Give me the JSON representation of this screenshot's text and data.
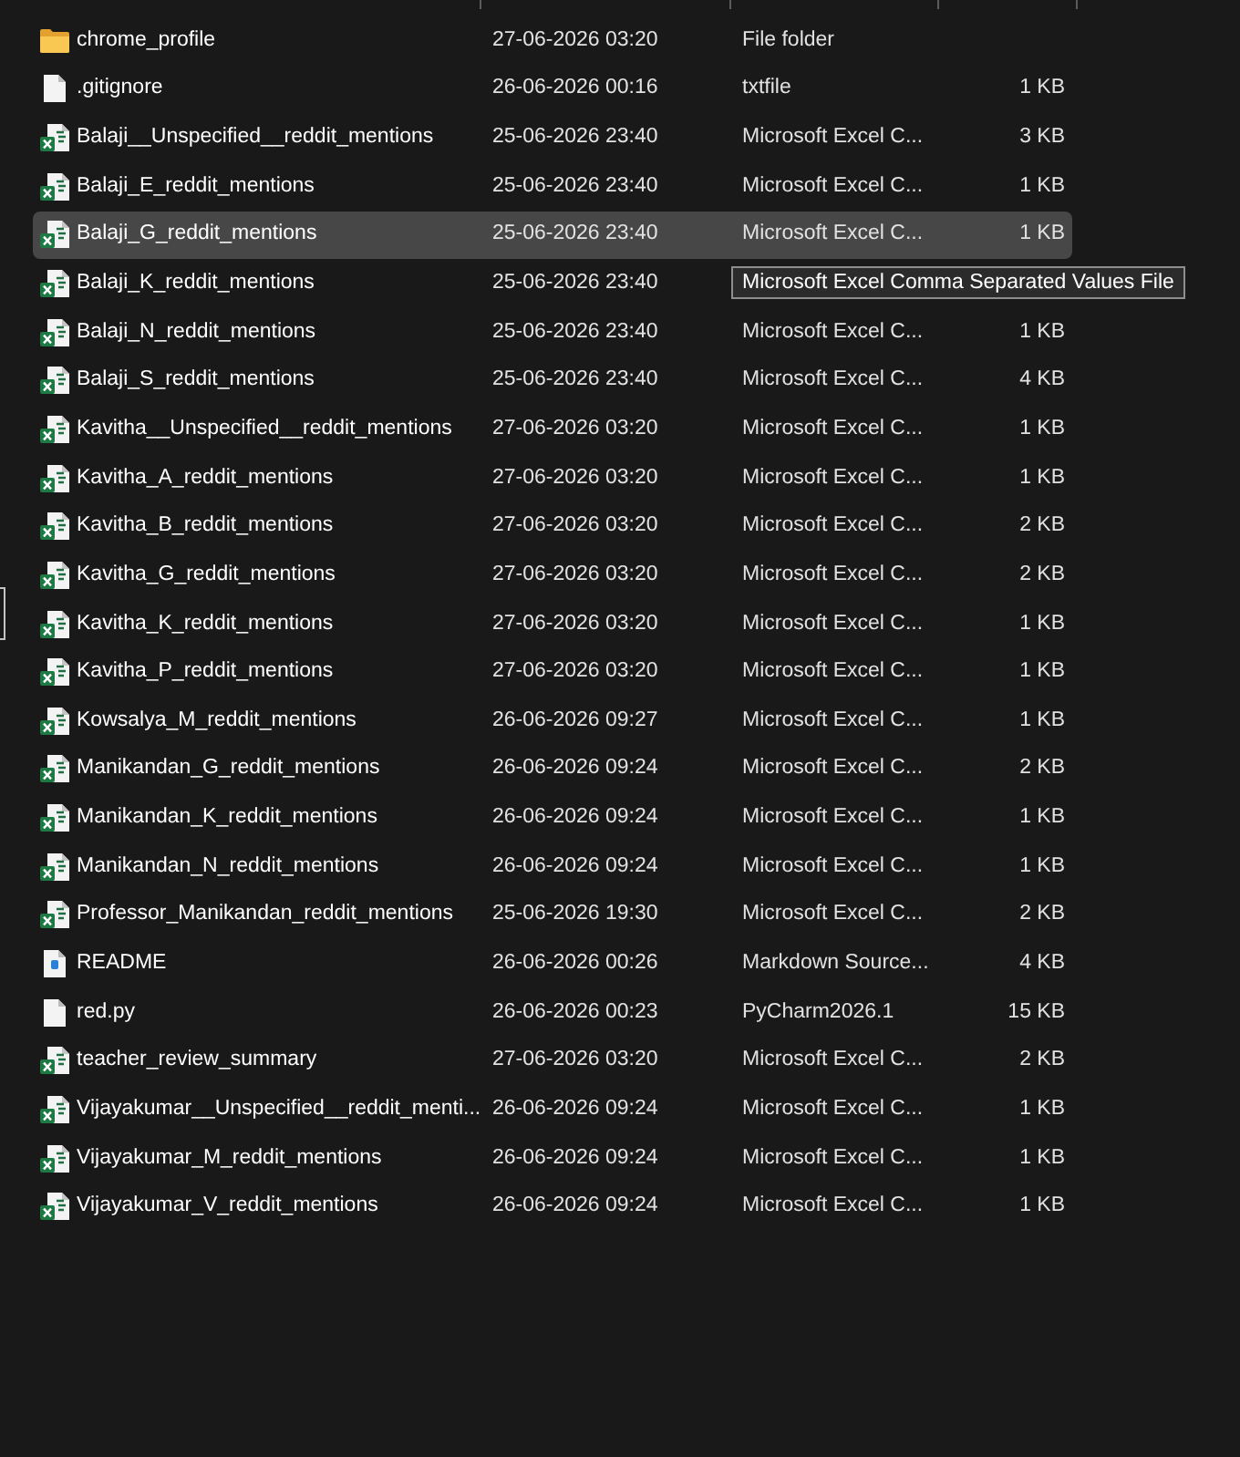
{
  "files": [
    {
      "kind": "folder",
      "name": "chrome_profile",
      "modified": "27-06-2026 03:20",
      "type": "File folder",
      "selected": false
    },
    {
      "kind": "file",
      "name": ".gitignore",
      "modified": "26-06-2026 00:16",
      "type": "txtfile",
      "size": "1 KB",
      "selected": false
    },
    {
      "kind": "csv",
      "name": "Balaji__Unspecified__reddit_mentions",
      "modified": "25-06-2026 23:40",
      "type": "Microsoft Excel C...",
      "size": "3 KB",
      "selected": false
    },
    {
      "kind": "csv",
      "name": "Balaji_E_reddit_mentions",
      "modified": "25-06-2026 23:40",
      "type": "Microsoft Excel C...",
      "size": "1 KB",
      "selected": false
    },
    {
      "kind": "csv",
      "name": "Balaji_G_reddit_mentions",
      "modified": "25-06-2026 23:40",
      "type": "Microsoft Excel C...",
      "size": "1 KB",
      "selected": true
    },
    {
      "kind": "csv",
      "name": "Balaji_K_reddit_mentions",
      "modified": "25-06-2026 23:40",
      "tooltip": "Microsoft Excel Comma Separated Values File",
      "selected": false
    },
    {
      "kind": "csv",
      "name": "Balaji_N_reddit_mentions",
      "modified": "25-06-2026 23:40",
      "type": "Microsoft Excel C...",
      "size": "1 KB",
      "selected": false
    },
    {
      "kind": "csv",
      "name": "Balaji_S_reddit_mentions",
      "modified": "25-06-2026 23:40",
      "type": "Microsoft Excel C...",
      "size": "4 KB",
      "selected": false
    },
    {
      "kind": "csv",
      "name": "Kavitha__Unspecified__reddit_mentions",
      "modified": "27-06-2026 03:20",
      "type": "Microsoft Excel C...",
      "size": "1 KB",
      "selected": false
    },
    {
      "kind": "csv",
      "name": "Kavitha_A_reddit_mentions",
      "modified": "27-06-2026 03:20",
      "type": "Microsoft Excel C...",
      "size": "1 KB",
      "selected": false
    },
    {
      "kind": "csv",
      "name": "Kavitha_B_reddit_mentions",
      "modified": "27-06-2026 03:20",
      "type": "Microsoft Excel C...",
      "size": "2 KB",
      "selected": false
    },
    {
      "kind": "csv",
      "name": "Kavitha_G_reddit_mentions",
      "modified": "27-06-2026 03:20",
      "type": "Microsoft Excel C...",
      "size": "2 KB",
      "selected": false
    },
    {
      "kind": "csv",
      "name": "Kavitha_K_reddit_mentions",
      "modified": "27-06-2026 03:20",
      "type": "Microsoft Excel C...",
      "size": "1 KB",
      "selected": false
    },
    {
      "kind": "csv",
      "name": "Kavitha_P_reddit_mentions",
      "modified": "27-06-2026 03:20",
      "type": "Microsoft Excel C...",
      "size": "1 KB",
      "selected": false
    },
    {
      "kind": "csv",
      "name": "Kowsalya_M_reddit_mentions",
      "modified": "26-06-2026 09:27",
      "type": "Microsoft Excel C...",
      "size": "1 KB",
      "selected": false
    },
    {
      "kind": "csv",
      "name": "Manikandan_G_reddit_mentions",
      "modified": "26-06-2026 09:24",
      "type": "Microsoft Excel C...",
      "size": "2 KB",
      "selected": false
    },
    {
      "kind": "csv",
      "name": "Manikandan_K_reddit_mentions",
      "modified": "26-06-2026 09:24",
      "type": "Microsoft Excel C...",
      "size": "1 KB",
      "selected": false
    },
    {
      "kind": "csv",
      "name": "Manikandan_N_reddit_mentions",
      "modified": "26-06-2026 09:24",
      "type": "Microsoft Excel C...",
      "size": "1 KB",
      "selected": false
    },
    {
      "kind": "csv",
      "name": "Professor_Manikandan_reddit_mentions",
      "modified": "25-06-2026 19:30",
      "type": "Microsoft Excel C...",
      "size": "2 KB",
      "selected": false
    },
    {
      "kind": "markdown",
      "name": "README",
      "modified": "26-06-2026 00:26",
      "type": "Markdown Source...",
      "size": "4 KB",
      "selected": false
    },
    {
      "kind": "file",
      "name": "red.py",
      "modified": "26-06-2026 00:23",
      "type": "PyCharm2026.1",
      "size": "15 KB",
      "selected": false
    },
    {
      "kind": "csv",
      "name": "teacher_review_summary",
      "modified": "27-06-2026 03:20",
      "type": "Microsoft Excel C...",
      "size": "2 KB",
      "selected": false
    },
    {
      "kind": "csv",
      "name": "Vijayakumar__Unspecified__reddit_menti...",
      "modified": "26-06-2026 09:24",
      "type": "Microsoft Excel C...",
      "size": "1 KB",
      "selected": false
    },
    {
      "kind": "csv",
      "name": "Vijayakumar_M_reddit_mentions",
      "modified": "26-06-2026 09:24",
      "type": "Microsoft Excel C...",
      "size": "1 KB",
      "selected": false
    },
    {
      "kind": "csv",
      "name": "Vijayakumar_V_reddit_mentions",
      "modified": "26-06-2026 09:24",
      "type": "Microsoft Excel C...",
      "size": "1 KB",
      "selected": false
    }
  ]
}
